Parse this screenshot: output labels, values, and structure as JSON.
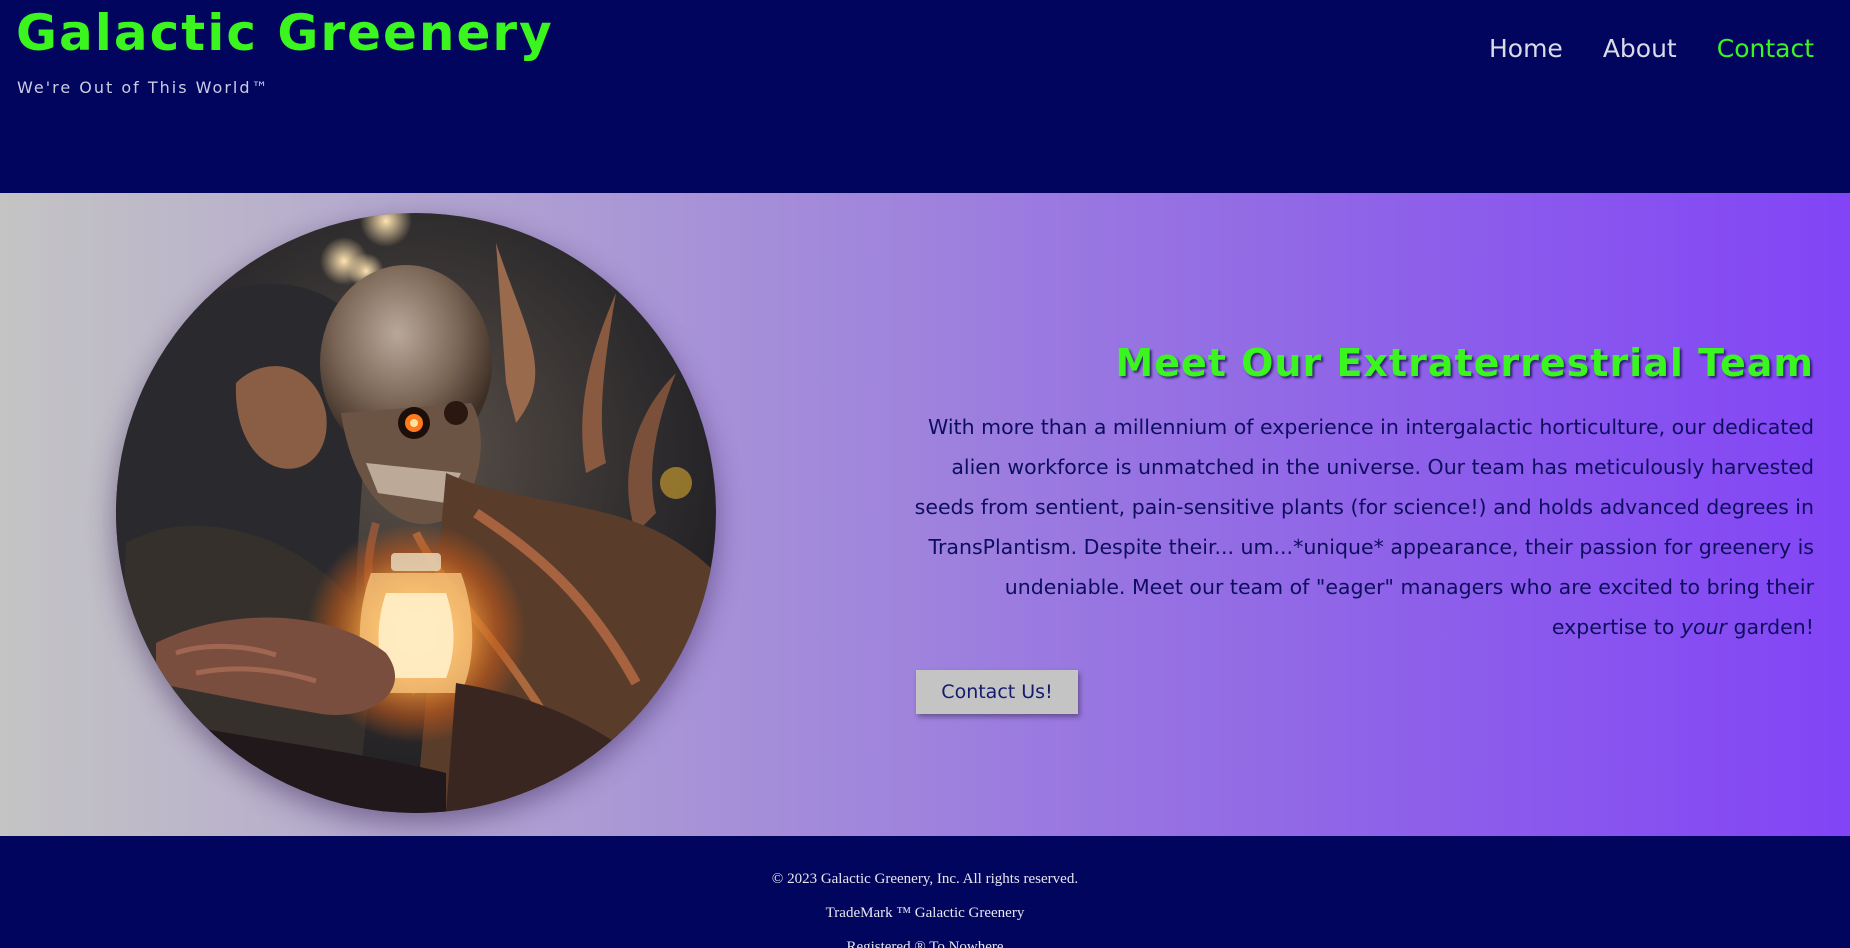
{
  "header": {
    "title": "Galactic Greenery",
    "tagline": "We're Out of This World™"
  },
  "nav": {
    "items": [
      {
        "label": "Home"
      },
      {
        "label": "About"
      },
      {
        "label": "Contact"
      }
    ],
    "active": "Contact"
  },
  "hero": {
    "image_alt": "alien creature holding a glowing jar next to a hooded man",
    "heading": "Meet Our Extraterrestrial Team",
    "body_main": "With more than a millennium of experience in intergalactic horticulture, our dedicated alien workforce is unmatched in the universe. Our team has meticulously harvested seeds from sentient, pain-sensitive plants (for science!) and holds advanced degrees in TransPlantism. Despite their... um...*unique* appearance, their passion for greenery is undeniable. Meet our team of \"eager\" managers who are excited to bring their expertise to ",
    "body_emphasis": "your",
    "body_end": " garden!",
    "button_label": "Contact Us!"
  },
  "footer": {
    "copyright": "© 2023 Galactic Greenery, Inc. All rights reserved.",
    "trademark": "TradeMark ™ Galactic Greenery",
    "registered": "Registered ® To Nowhere"
  },
  "colors": {
    "background": "#02055e",
    "accent_green": "#3bf51f",
    "hero_gradient_start": "#c4c4c4",
    "hero_gradient_end": "#8244f6",
    "button_bg": "#c4c4c4",
    "body_text": "#0d0e5e"
  }
}
